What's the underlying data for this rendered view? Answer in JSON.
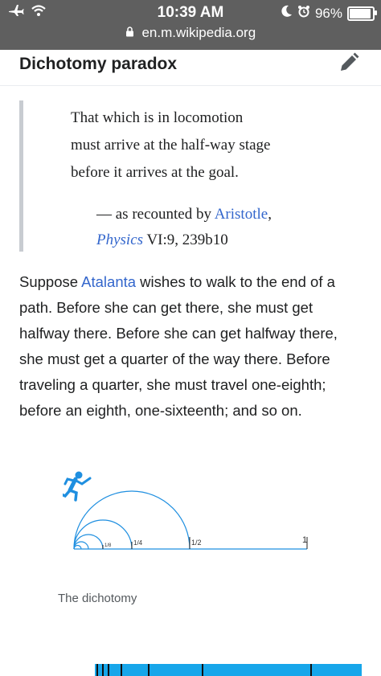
{
  "status_bar": {
    "time": "10:39 AM",
    "battery_text": "96%",
    "battery_level": 0.96,
    "url": "en.m.wikipedia.org",
    "icons": [
      "airplane-icon",
      "wifi-icon",
      "moon-icon",
      "alarm-icon",
      "lock-icon",
      "battery-icon"
    ]
  },
  "section": {
    "heading": "Dichotomy paradox",
    "edit_icon": "pencil-icon"
  },
  "quote": {
    "line1": "That which is in locomotion",
    "line2": "must arrive at the half-way stage",
    "line3": "before it arrives at the goal.",
    "attrib_prefix": "— as recounted by ",
    "attrib_link": "Aristotle",
    "attrib_suffix": ",",
    "work_link": "Physics",
    "work_ref": " VI:9, 239b10"
  },
  "paragraph": {
    "before_link": "Suppose ",
    "link": "Atalanta",
    "after_link": " wishes to walk to the end of a path. Before she can get there, she must get halfway there. Before she can get halfway there, she must get a quarter of the way there. Before traveling a quarter, she must travel one-eighth; before an eighth, one-sixteenth; and so on."
  },
  "figure": {
    "labels": [
      "1/8",
      "1/4",
      "1/2",
      "1"
    ],
    "caption": "The dichotomy",
    "runner_icon": "runner-icon"
  },
  "colors": {
    "link": "#3366cc",
    "status_bar": "#5f5f5f",
    "figure_blue": "#1f8fe0"
  }
}
